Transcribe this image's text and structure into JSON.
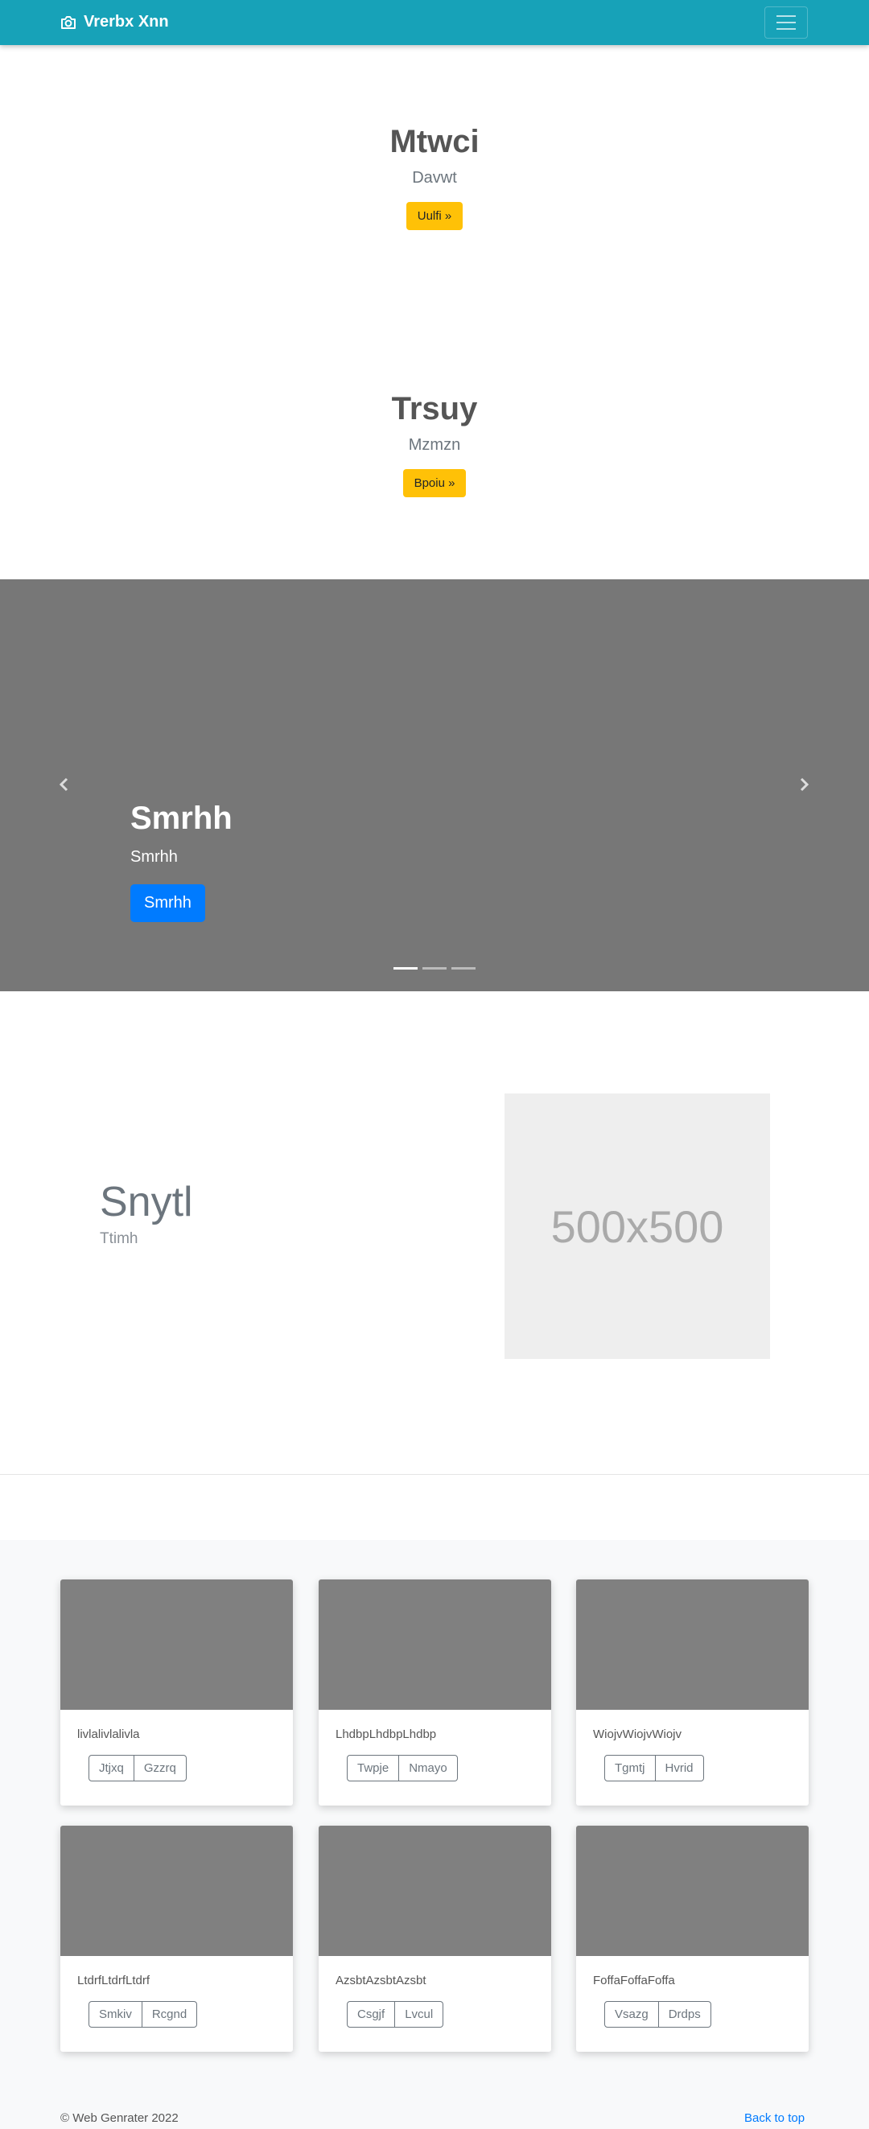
{
  "navbar": {
    "brand": "Vrerbx Xnn",
    "brand_icon": "camera-icon",
    "toggler_icon": "hamburger-icon",
    "background": "#17a2b8"
  },
  "hero1": {
    "title": "Mtwci",
    "subtitle": "Davwt",
    "button": "Uulfi »"
  },
  "hero2": {
    "title": "Trsuy",
    "subtitle": "Mzmzn",
    "button": "Bpoiu »"
  },
  "carousel": {
    "title": "Smrhh",
    "subtitle": "Smrhh",
    "button": "Smrhh",
    "prev_icon": "chevron-left-icon",
    "next_icon": "chevron-right-icon",
    "slide_count": 3,
    "active_slide": 1
  },
  "featurette": {
    "title": "Snytl",
    "subtitle": "Ttimh",
    "placeholder": "500x500"
  },
  "cards": [
    {
      "text": "livlalivlalivla",
      "buttons": [
        "Jtjxq",
        "Gzzrq"
      ]
    },
    {
      "text": "LhdbpLhdbpLhdbp",
      "buttons": [
        "Twpje",
        "Nmayo"
      ]
    },
    {
      "text": "WiojvWiojvWiojv",
      "buttons": [
        "Tgmtj",
        "Hvrid"
      ]
    },
    {
      "text": "LtdrfLtdrfLtdrf",
      "buttons": [
        "Smkiv",
        "Rcgnd"
      ]
    },
    {
      "text": "AzsbtAzsbtAzsbt",
      "buttons": [
        "Csgjf",
        "Lvcul"
      ]
    },
    {
      "text": "FoffaFoffaFoffa",
      "buttons": [
        "Vsazg",
        "Drdps"
      ]
    }
  ],
  "footer": {
    "copyright": "© Web Genrater 2022",
    "back_to_top": "Back to top"
  }
}
